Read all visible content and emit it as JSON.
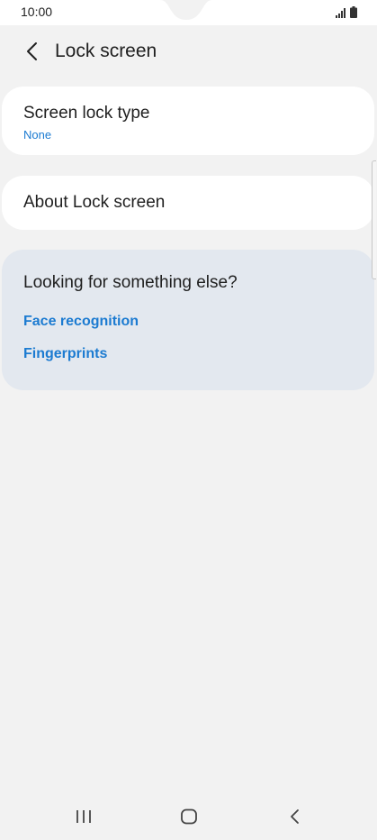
{
  "status_bar": {
    "time": "10:00",
    "icons": [
      "signal-icon",
      "battery-icon"
    ]
  },
  "header": {
    "back_icon": "back-arrow-icon",
    "title": "Lock screen"
  },
  "settings": {
    "screen_lock_type": {
      "title": "Screen lock type",
      "value": "None"
    },
    "about": {
      "title": "About Lock screen"
    }
  },
  "suggestions": {
    "title": "Looking for something else?",
    "links": [
      "Face recognition",
      "Fingerprints"
    ]
  },
  "nav_bar": {
    "icons": [
      "recent-apps-icon",
      "home-icon",
      "back-icon"
    ]
  },
  "colors": {
    "background": "#f2f2f2",
    "card": "#ffffff",
    "suggest_card": "#e3e8ef",
    "accent": "#1c7bd1",
    "text": "#1f1f1f"
  }
}
